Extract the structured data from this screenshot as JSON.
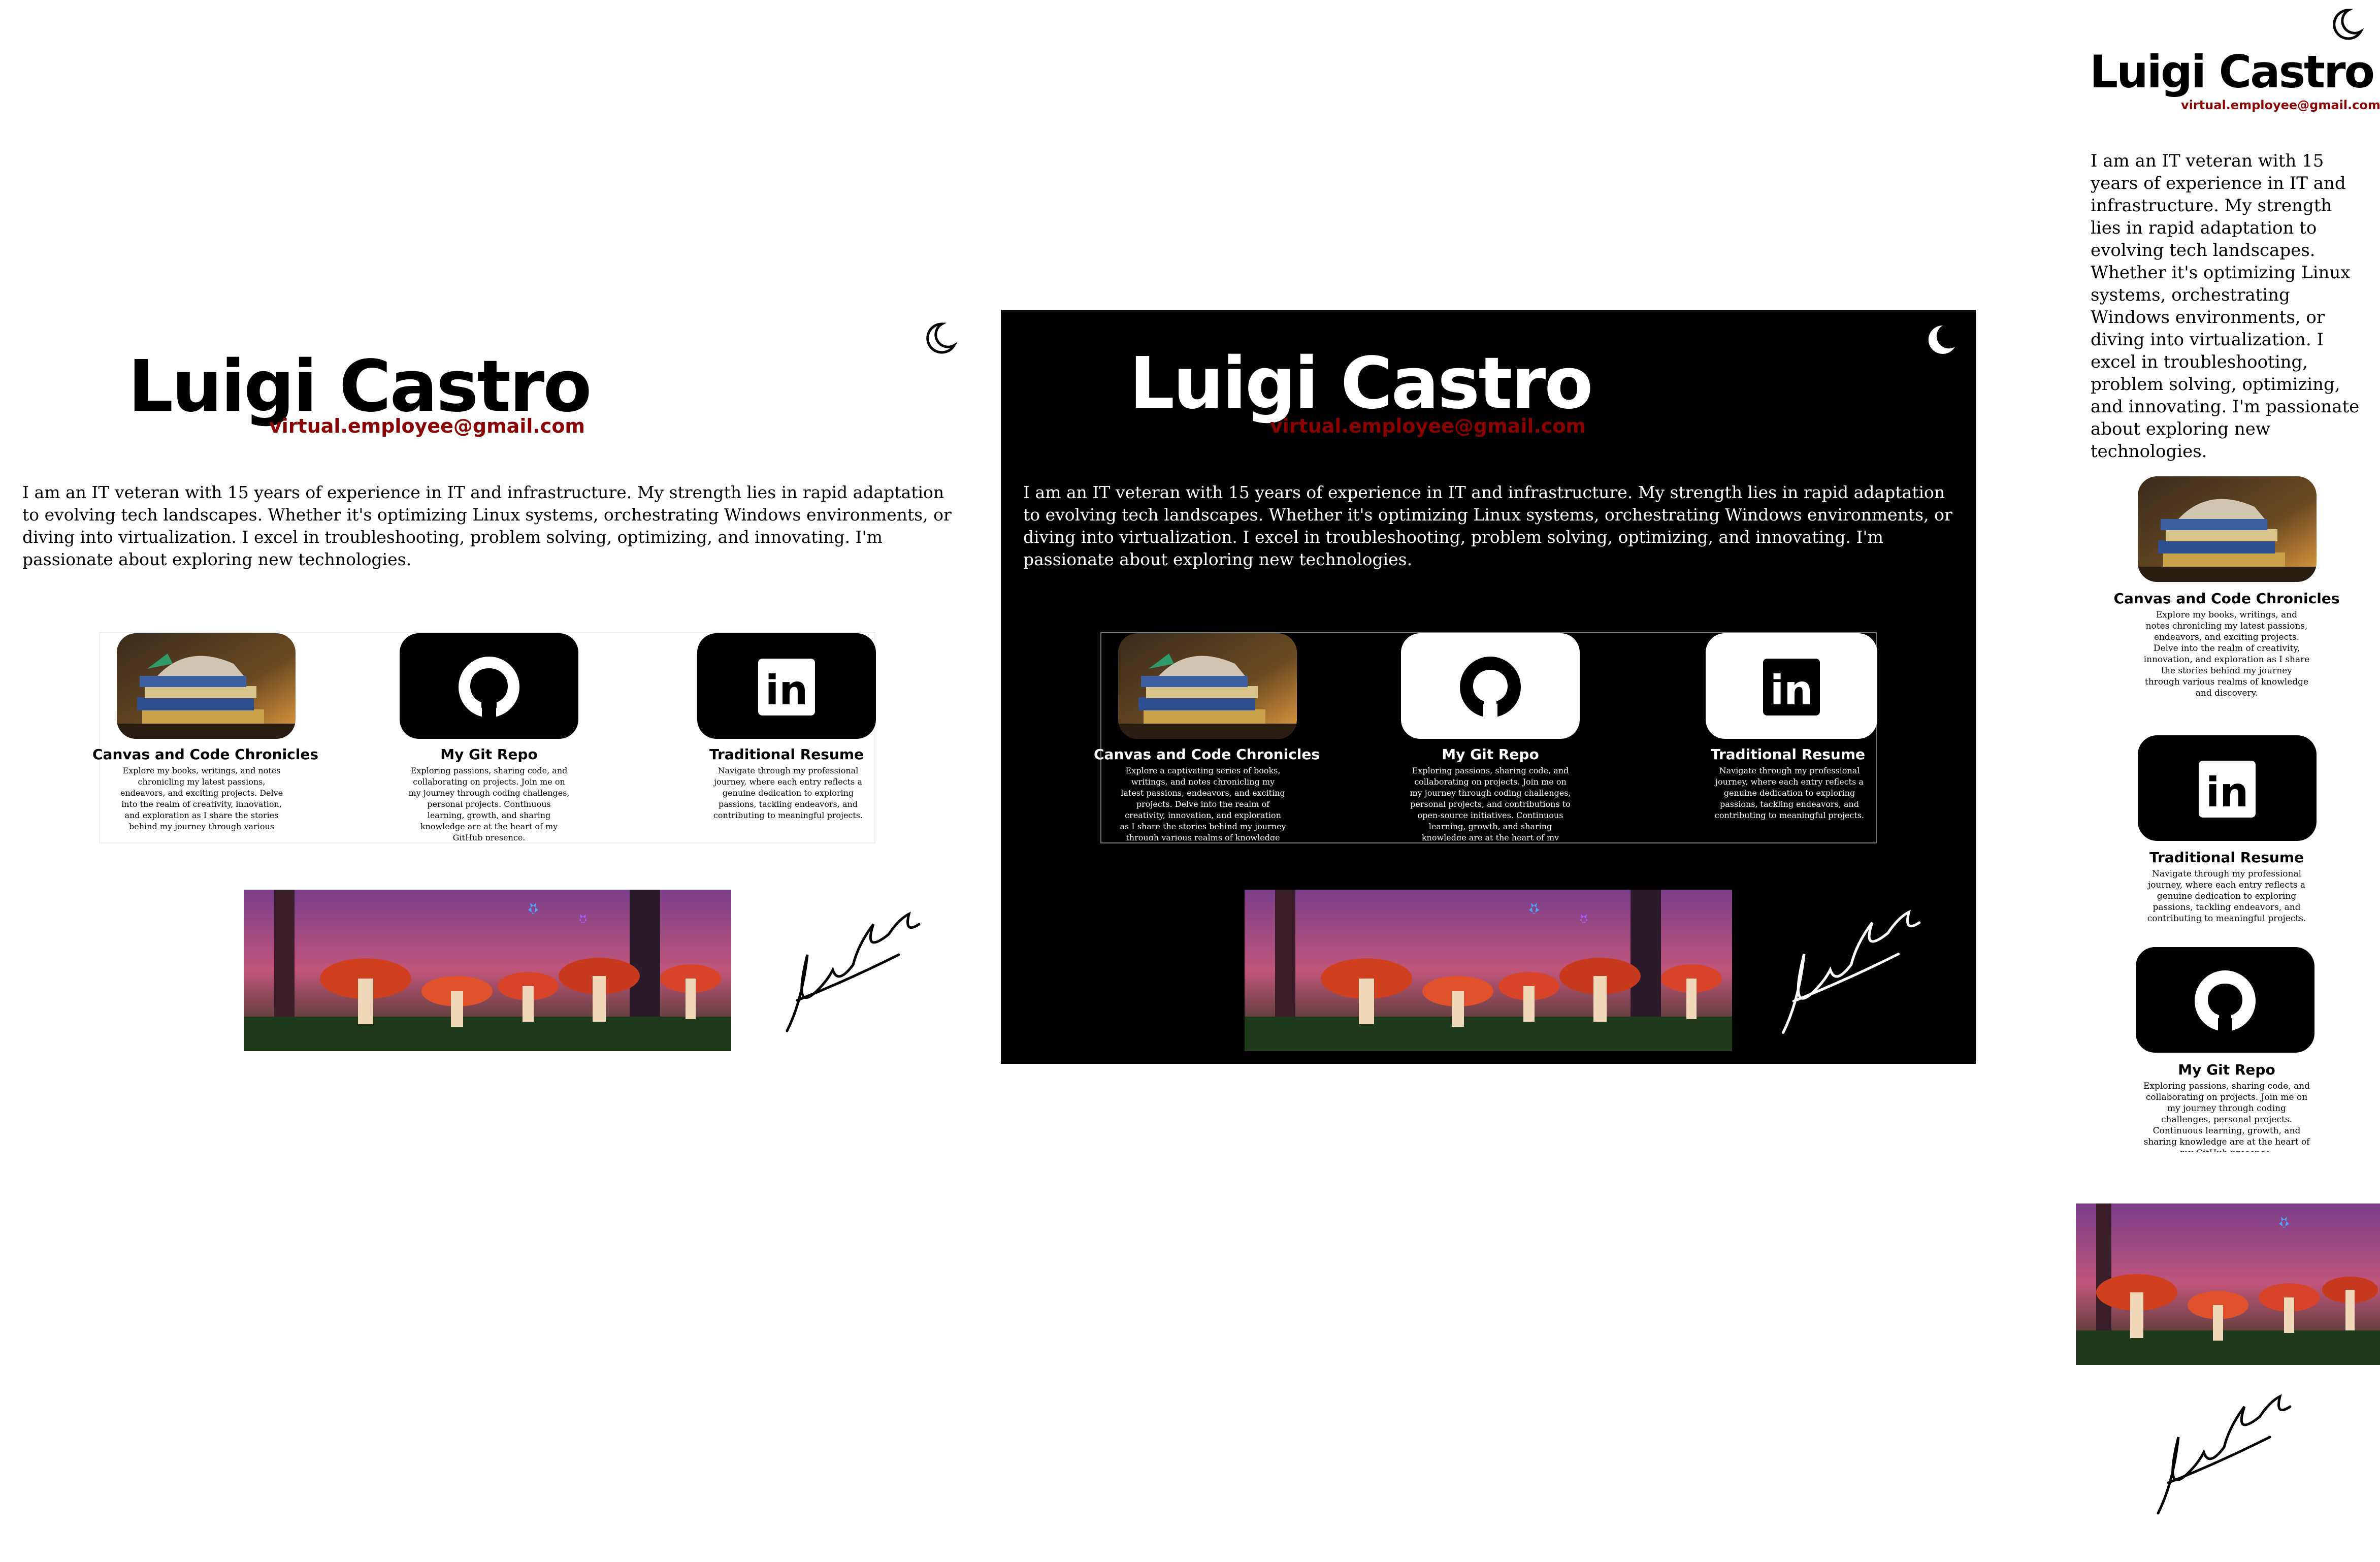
{
  "profile": {
    "name": "Luigi Castro",
    "email": "virtual.employee@gmail.com",
    "bio": "I am an IT veteran with 15 years of experience in IT and infrastructure. My strength lies in rapid adaptation to evolving tech landscapes. Whether it's optimizing Linux systems, orchestrating Windows environments, or diving into virtualization. I excel in troubleshooting, problem solving, optimizing, and innovating. I'm passionate about exploring new technologies."
  },
  "cards": {
    "chronicles": {
      "title": "Canvas and Code Chronicles",
      "desc_light": "Explore my  books, writings, and notes chronicling my latest passions, endeavors, and exciting projects. Delve into the realm of creativity, innovation, and exploration as I share the stories behind my journey through various",
      "desc_dark": "Explore a captivating series of books, writings, and notes chronicling my latest passions, endeavors, and exciting projects. Delve into the realm of creativity, innovation, and exploration as I share the stories behind my journey through various realms of knowledge and discovery.",
      "desc_mobile": "Explore my  books, writings, and notes chronicling my latest passions, endeavors, and exciting projects. Delve into the realm of creativity, innovation, and exploration as I share the stories behind my journey through various realms of knowledge and discovery."
    },
    "git": {
      "title": "My Git Repo",
      "desc_light": "Exploring passions, sharing code, and collaborating on projects. Join me on my journey through coding challenges, personal projects. Continuous learning, growth, and sharing knowledge are at the heart of my GitHub presence.",
      "desc_dark": "Exploring passions, sharing code, and collaborating on projects. Join me on my journey through coding challenges, personal projects, and contributions to open-source initiatives. Continuous learning, growth, and sharing knowledge are at the heart of my GitHub presence.",
      "desc_mobile": "Exploring passions, sharing code, and collaborating on projects. Join me on my journey through coding challenges, personal projects. Continuous learning, growth, and sharing knowledge are at the heart of my GitHub presence."
    },
    "resume": {
      "title": "Traditional Resume",
      "desc": "Navigate through my professional journey, where each entry reflects a genuine dedication to exploring passions, tackling endeavors, and contributing to meaningful projects."
    }
  },
  "icons": {
    "moon": "moon-icon",
    "github": "github-icon",
    "linkedin": "linkedin-icon",
    "linkedin_glyph": "in"
  },
  "colors": {
    "email": "#8b0000",
    "dark_bg": "#000000",
    "light_bg": "#ffffff"
  }
}
